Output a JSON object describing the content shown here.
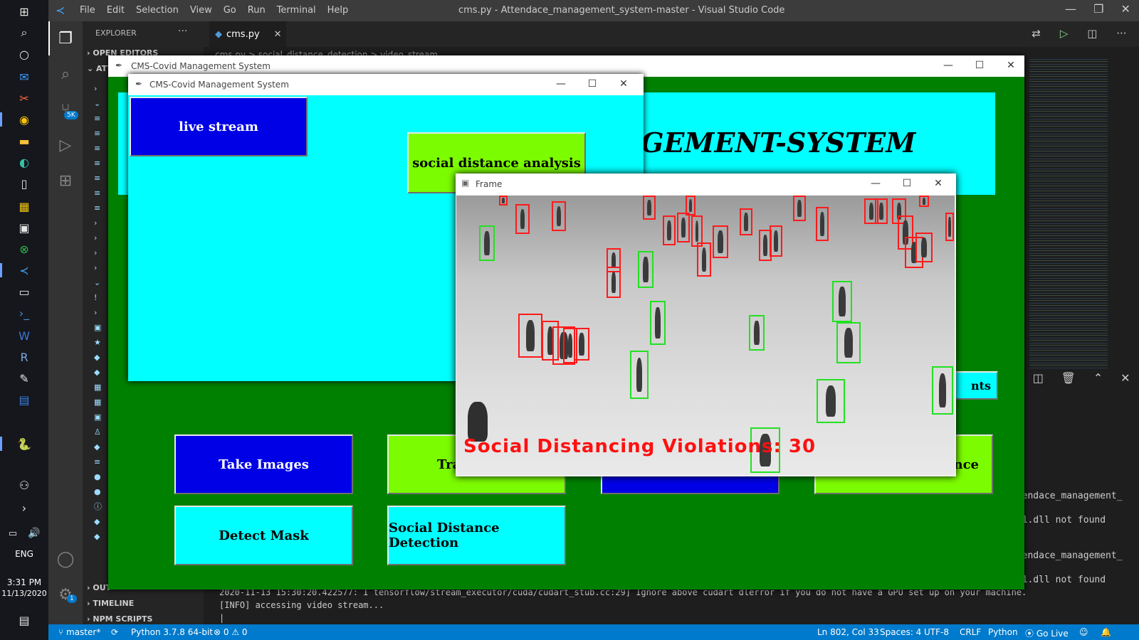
{
  "taskbar": {
    "time": "3:31 PM",
    "date": "11/13/2020",
    "language": "ENG",
    "icons": [
      "windows-icon",
      "search-icon",
      "cortana-icon",
      "mail-icon",
      "snipping-icon",
      "chrome-icon",
      "file-explorer-icon",
      "edge-icon",
      "notepad-icon",
      "powerbi-icon",
      "store-icon",
      "xbox-icon",
      "vscode-icon",
      "terminal-icon",
      "powershell-icon",
      "word-icon",
      "r-icon",
      "paint-icon",
      "whiteboard-icon",
      "python-idle-icon"
    ]
  },
  "vscode": {
    "menu": [
      "File",
      "Edit",
      "Selection",
      "View",
      "Go",
      "Run",
      "Terminal",
      "Help"
    ],
    "title": "cms.py - Attendace_management_system-master - Visual Studio Code",
    "tab": "cms.py",
    "breadcrumb": [
      "cms.py",
      "social_distance_detection",
      "video_stream"
    ],
    "explorer_title": "EXPLORER",
    "open_editors": "OPEN EDITORS",
    "folder_short": "ATT",
    "outline": "OUT",
    "timeline": "TIMELINE",
    "npm_scripts": "NPM SCRIPTS",
    "scm_badge": "5K",
    "settings_badge": "1",
    "terminal_lines": [
      "2020-11-13 15:30:20.422577: I tensorflow/stream_executor/cuda/cudart_stub.cc:29] Ignore above cudart dlerror if you do not have a GPU set up on your machine.",
      "[INFO] accessing video stream...",
      "|"
    ],
    "terminal_right": [
      "ttendace_management_",
      "101.dll not found",
      "ttendace_management_",
      "101.dll not found"
    ],
    "status": {
      "branch": "master*",
      "python": "Python 3.7.8 64-bit",
      "errors": "0",
      "warnings": "0",
      "position": "Ln 802, Col 33",
      "spaces": "Spaces: 4",
      "encoding": "UTF-8",
      "eol": "CRLF",
      "language": "Python",
      "golive": "Go Live"
    }
  },
  "cms_main": {
    "title": "CMS-Covid Management System",
    "banner_fragment": "GEMENT-SYSTEM",
    "buttons": {
      "take_images": "Take Images",
      "train_fragment": "Tra",
      "attendance_fragment": "nce",
      "students_fragment": "nts",
      "detect_mask": "Detect Mask",
      "social_distance_detection": "Social Distance Detection"
    },
    "colors": {
      "bg": "#008000",
      "cyan": "#00ffff",
      "lime": "#7cfc00",
      "blue": "#0000e6"
    }
  },
  "cms_sub": {
    "title": "CMS-Covid Management System",
    "live_stream": "live stream",
    "social_distance_analysis": "social distance analysis"
  },
  "frame": {
    "title": "Frame",
    "violations_label": "Social Distancing Violations: 30"
  }
}
